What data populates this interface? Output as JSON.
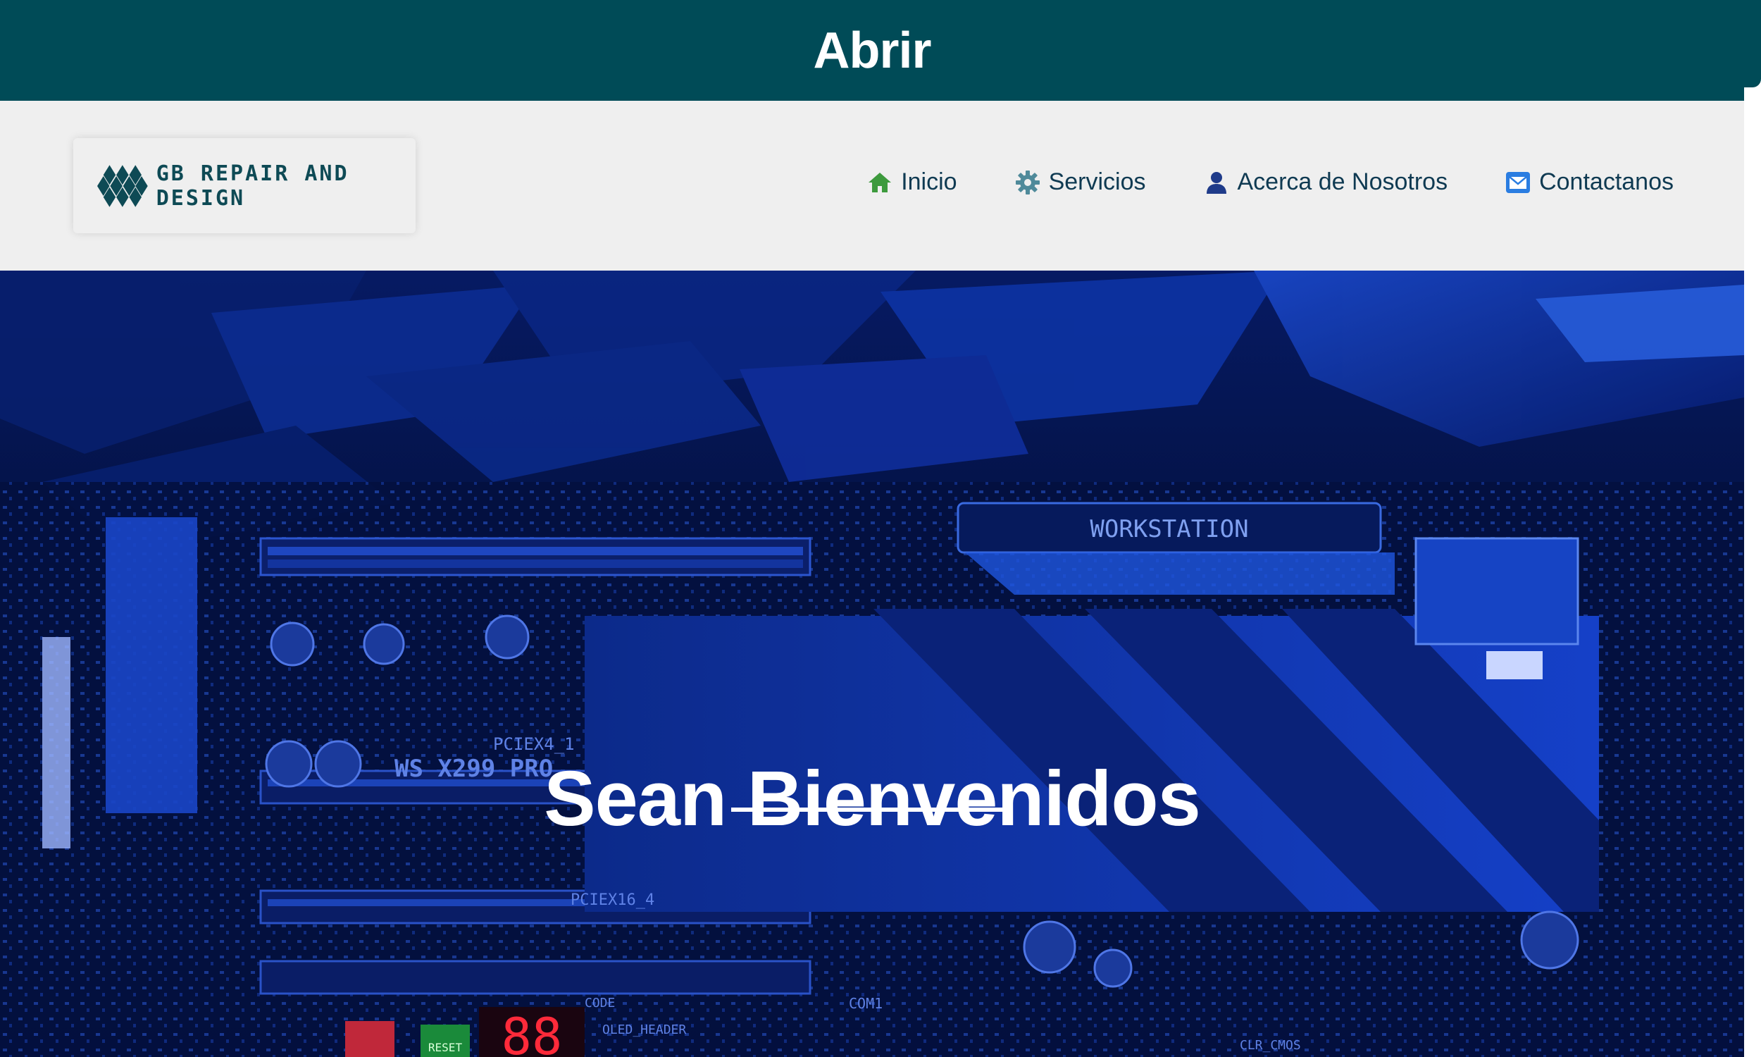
{
  "top_bar": {
    "title": "Abrir"
  },
  "header": {
    "logo_text": "GB REPAIR AND DESIGN",
    "nav": [
      {
        "label": "Inicio",
        "icon": "home-icon"
      },
      {
        "label": "Servicios",
        "icon": "gear-icon"
      },
      {
        "label": "Acerca de Nosotros",
        "icon": "user-icon"
      },
      {
        "label": "Contactanos",
        "icon": "mail-icon"
      }
    ]
  },
  "hero": {
    "title": "Sean Bienvenidos",
    "board_labels": {
      "workstation": "WORKSTATION",
      "model": "WS X299 PRO",
      "pciex4": "PCIEX4_1",
      "pciex16": "PCIEX16_4",
      "code": "CODE",
      "oled": "OLED_HEADER",
      "com": "COM1",
      "clr": "CLR_CMOS",
      "reset": "RESET",
      "debug": "88"
    }
  },
  "colors": {
    "brand": "#004b57",
    "header_bg": "#efefef",
    "nav_text": "#0f3a52",
    "hero_blue": "#0a2cc0"
  }
}
